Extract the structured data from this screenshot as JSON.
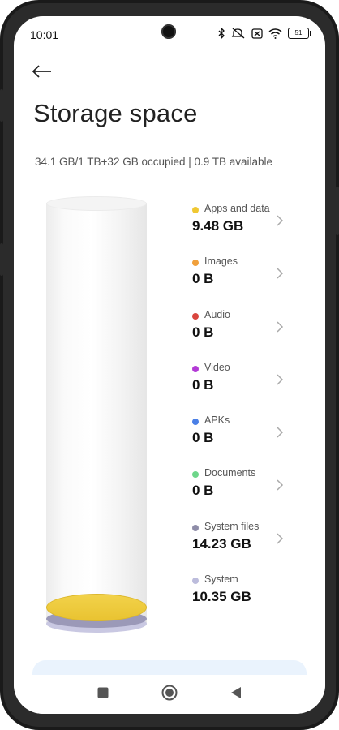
{
  "status_bar": {
    "time": "10:01",
    "battery": "51",
    "icons": [
      "bluetooth-icon",
      "mute-icon",
      "sim-off-icon",
      "wifi-icon",
      "battery-icon"
    ]
  },
  "header": {
    "back_icon": "back-arrow-icon",
    "title": "Storage space",
    "summary": "34.1 GB/1 TB+32 GB occupied | 0.9 TB available"
  },
  "categories": [
    {
      "label": "Apps and data",
      "value": "9.48 GB",
      "color": "#f0c833"
    },
    {
      "label": "Images",
      "value": "0 B",
      "color": "#f0a03c"
    },
    {
      "label": "Audio",
      "value": "0 B",
      "color": "#d9453e"
    },
    {
      "label": "Video",
      "value": "0 B",
      "color": "#b33ad6"
    },
    {
      "label": "APKs",
      "value": "0 B",
      "color": "#4a7fe6"
    },
    {
      "label": "Documents",
      "value": "0 B",
      "color": "#6ed68a"
    },
    {
      "label": "System files",
      "value": "14.23 GB",
      "color": "#8e8ca8"
    },
    {
      "label": "System",
      "value": "10.35 GB",
      "color": "#bcbcdc"
    }
  ],
  "nav": {
    "recents_icon": "square-icon",
    "home_icon": "circle-home-icon",
    "back_icon": "triangle-back-icon"
  },
  "colors": {
    "accent_card": "#eaf3fd",
    "text_primary": "#222222"
  }
}
